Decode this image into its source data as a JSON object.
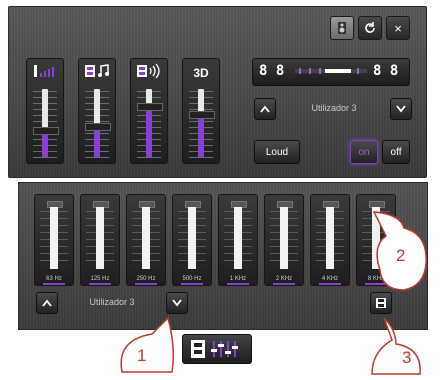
{
  "window": {
    "close_label": "×",
    "speaker_icon": "speaker-icon",
    "reset_icon": "refresh-icon"
  },
  "controls": [
    {
      "name": "bass",
      "icon": "volume-bars-icon",
      "label": ""
    },
    {
      "name": "music",
      "icon": "music-note-icon",
      "label": "♫"
    },
    {
      "name": "surround",
      "icon": "speaker-waves-icon",
      "label": ")))"
    },
    {
      "name": "3d",
      "icon": "",
      "label": "3D"
    }
  ],
  "balance": {
    "left_display": "8 8",
    "right_display": "8 8"
  },
  "preset_top": {
    "label": "Utilizador 3",
    "up": "^",
    "down": "v"
  },
  "buttons": {
    "loud": "Loud",
    "on": "on",
    "off": "off"
  },
  "eq": {
    "bands": [
      "63 Hz",
      "125 Hz",
      "250 Hz",
      "500 Hz",
      "1 KHz",
      "2 KHz",
      "4 KHz",
      "8 KHz"
    ],
    "preset_label": "Utilizador 3",
    "up": "^",
    "down": "v",
    "save_icon": "save-icon"
  },
  "callouts": [
    "1",
    "2",
    "3"
  ],
  "colors": {
    "accent": "#8a3fd4",
    "callout": "#c0392b"
  }
}
